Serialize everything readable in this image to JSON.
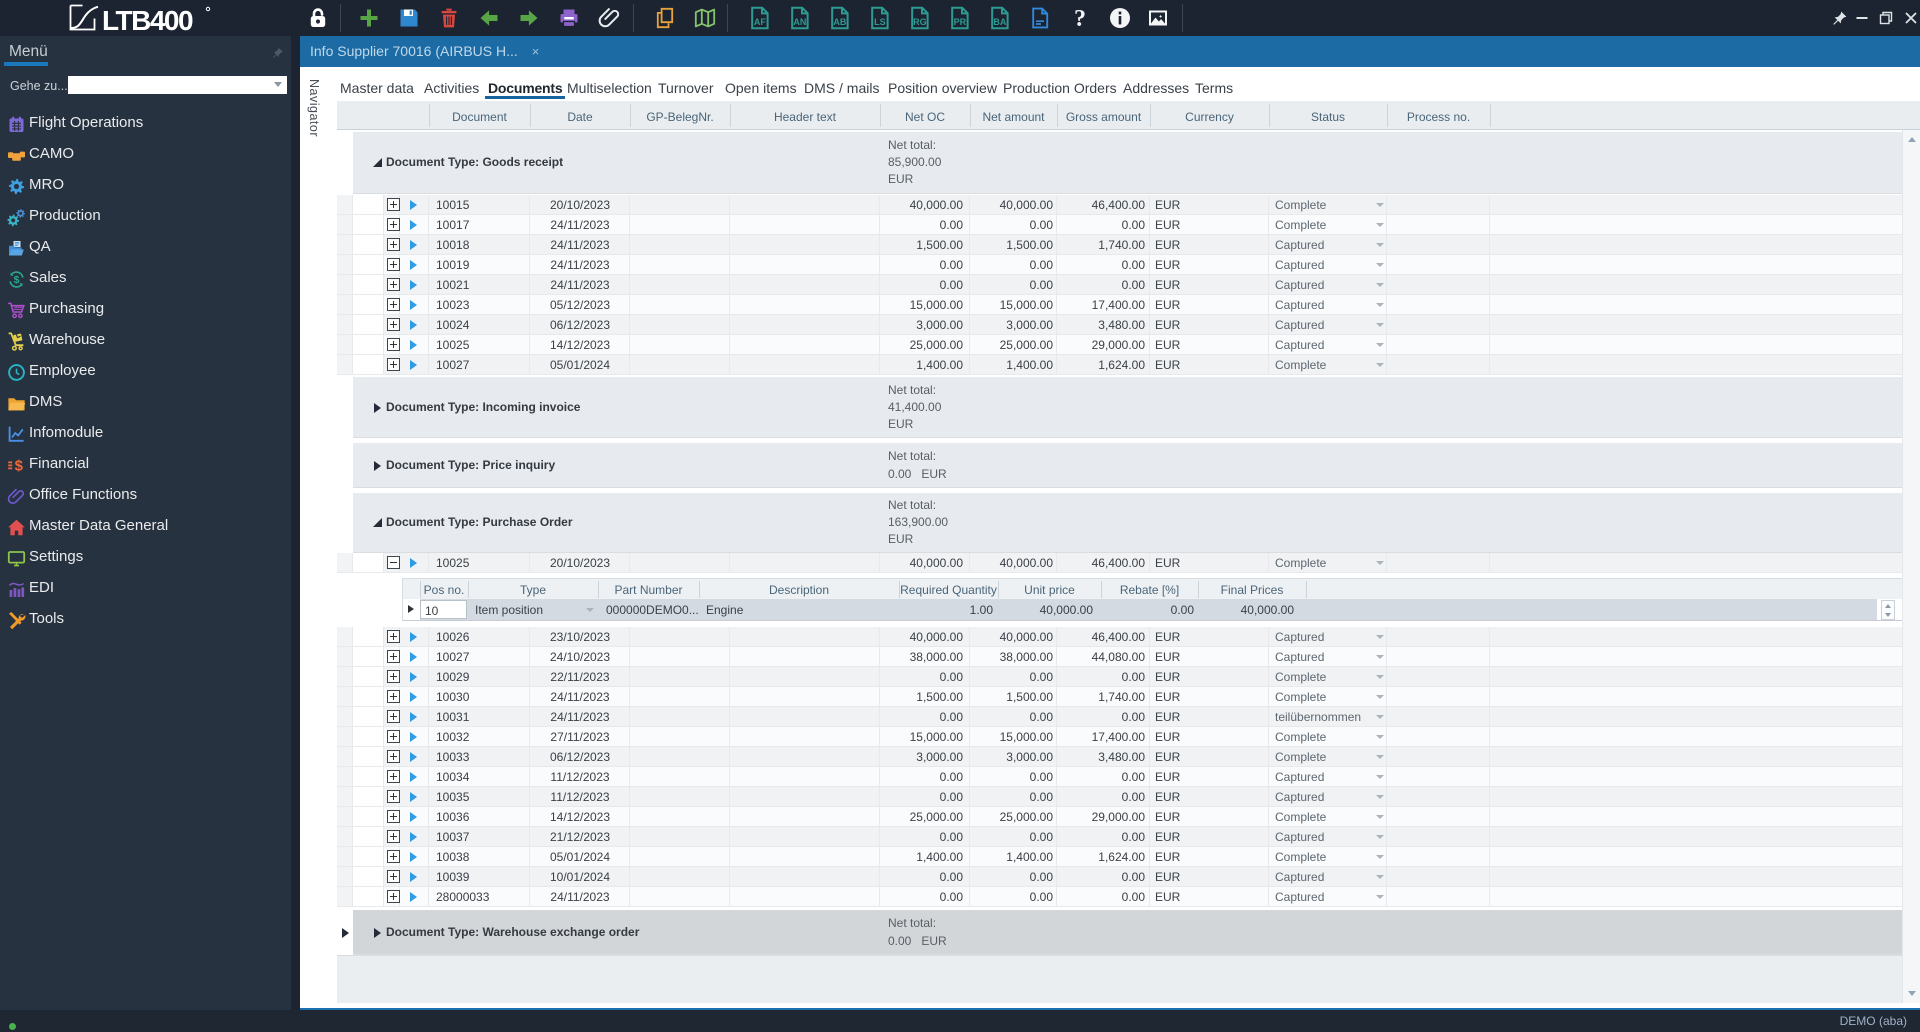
{
  "colors": {
    "topbar_bg": "#1c2431",
    "sidebar_bg": "#273240",
    "statusbar_bg": "#1f2733",
    "tab_blue": "#1d6ba5",
    "accent_blue": "#1a6fae",
    "underline_blue": "#1a79bd",
    "header_bg": "#e9edf0",
    "group_bg": "#e7eaee",
    "group_selected_bg": "#d3d6d9",
    "subrow_bg": "#d3dae2",
    "status_green": "#4db04e"
  },
  "window": {
    "logo_text": "LTB400",
    "status_user": "DEMO (aba)"
  },
  "window_buttons": [
    {
      "icon": "pin-icon"
    },
    {
      "icon": "minimize-icon"
    },
    {
      "icon": "restore-icon"
    },
    {
      "icon": "close-icon"
    }
  ],
  "toolbar": {
    "icons": [
      {
        "icon": "lock-icon"
      },
      {
        "sep": true
      },
      {
        "icon": "add-icon"
      },
      {
        "icon": "save-icon"
      },
      {
        "icon": "delete-icon"
      },
      {
        "icon": "back-arrow-icon"
      },
      {
        "icon": "forward-arrow-icon"
      },
      {
        "icon": "print-icon"
      },
      {
        "icon": "attachment-icon"
      },
      {
        "sep": true
      },
      {
        "icon": "copy-icon"
      },
      {
        "icon": "map-icon"
      },
      {
        "sep": true
      },
      {
        "icon": "doc-icon",
        "label": "AF"
      },
      {
        "icon": "doc-icon",
        "label": "AN"
      },
      {
        "icon": "doc-icon",
        "label": "AB"
      },
      {
        "icon": "doc-icon",
        "label": "LS"
      },
      {
        "icon": "doc-icon",
        "label": "RG"
      },
      {
        "icon": "doc-icon",
        "label": "PR"
      },
      {
        "icon": "doc-icon",
        "label": "BA"
      },
      {
        "icon": "doc-blue-icon"
      },
      {
        "icon": "help-icon"
      },
      {
        "icon": "info-icon"
      },
      {
        "icon": "image-icon"
      },
      {
        "sep": true
      }
    ]
  },
  "sidebar": {
    "title": "Menü",
    "goto_label": "Gehe zu...",
    "goto_value": "",
    "items": [
      {
        "label": "Flight Operations",
        "icon": "flight-operations-icon"
      },
      {
        "label": "CAMO",
        "icon": "camo-icon"
      },
      {
        "label": "MRO",
        "icon": "mro-icon"
      },
      {
        "label": "Production",
        "icon": "production-icon"
      },
      {
        "label": "QA",
        "icon": "qa-icon"
      },
      {
        "label": "Sales",
        "icon": "sales-icon"
      },
      {
        "label": "Purchasing",
        "icon": "purchasing-icon"
      },
      {
        "label": "Warehouse",
        "icon": "warehouse-icon"
      },
      {
        "label": "Employee",
        "icon": "employee-icon"
      },
      {
        "label": "DMS",
        "icon": "dms-icon"
      },
      {
        "label": "Infomodule",
        "icon": "infomodule-icon"
      },
      {
        "label": "Financial",
        "icon": "financial-icon"
      },
      {
        "label": "Office Functions",
        "icon": "office-functions-icon"
      },
      {
        "label": "Master Data General",
        "icon": "master-data-icon"
      },
      {
        "label": "Settings",
        "icon": "settings-icon"
      },
      {
        "label": "EDI",
        "icon": "edi-icon"
      },
      {
        "label": "Tools",
        "icon": "tools-icon"
      }
    ]
  },
  "document_tab": {
    "title": "Info Supplier 70016 (AIRBUS H...",
    "close": "×"
  },
  "navigator": {
    "label": "Navigator"
  },
  "content_tabs": {
    "active": "Documents",
    "items": [
      "Master data",
      "Activities",
      "Documents",
      "Multiselection",
      "Turnover",
      "Open items",
      "DMS / mails",
      "Position overview",
      "Production Orders",
      "Addresses",
      "Terms"
    ]
  },
  "grid": {
    "columns": [
      "Document",
      "Date",
      "GP-BelegNr.",
      "Header text",
      "Net OC",
      "Net amount",
      "Gross amount",
      "Currency",
      "Status",
      "Process no."
    ],
    "groups": [
      {
        "label": "Document Type: Goods receipt",
        "expanded": true,
        "compact": false,
        "net_total": {
          "caption": "Net total:",
          "value": "85,900.00",
          "currency": "EUR"
        },
        "rows": [
          {
            "document": "10015",
            "date": "20/10/2023",
            "net_oc": "40,000.00",
            "net_amount": "40,000.00",
            "gross_amount": "46,400.00",
            "currency": "EUR",
            "status": "Complete",
            "alt": true
          },
          {
            "document": "10017",
            "date": "24/11/2023",
            "net_oc": "0.00",
            "net_amount": "0.00",
            "gross_amount": "0.00",
            "currency": "EUR",
            "status": "Complete",
            "alt": false
          },
          {
            "document": "10018",
            "date": "24/11/2023",
            "net_oc": "1,500.00",
            "net_amount": "1,500.00",
            "gross_amount": "1,740.00",
            "currency": "EUR",
            "status": "Captured",
            "alt": true
          },
          {
            "document": "10019",
            "date": "24/11/2023",
            "net_oc": "0.00",
            "net_amount": "0.00",
            "gross_amount": "0.00",
            "currency": "EUR",
            "status": "Captured",
            "alt": false
          },
          {
            "document": "10021",
            "date": "24/11/2023",
            "net_oc": "0.00",
            "net_amount": "0.00",
            "gross_amount": "0.00",
            "currency": "EUR",
            "status": "Captured",
            "alt": true
          },
          {
            "document": "10023",
            "date": "05/12/2023",
            "net_oc": "15,000.00",
            "net_amount": "15,000.00",
            "gross_amount": "17,400.00",
            "currency": "EUR",
            "status": "Captured",
            "alt": false
          },
          {
            "document": "10024",
            "date": "06/12/2023",
            "net_oc": "3,000.00",
            "net_amount": "3,000.00",
            "gross_amount": "3,480.00",
            "currency": "EUR",
            "status": "Captured",
            "alt": true
          },
          {
            "document": "10025",
            "date": "14/12/2023",
            "net_oc": "25,000.00",
            "net_amount": "25,000.00",
            "gross_amount": "29,000.00",
            "currency": "EUR",
            "status": "Captured",
            "alt": false
          },
          {
            "document": "10027",
            "date": "05/01/2024",
            "net_oc": "1,400.00",
            "net_amount": "1,400.00",
            "gross_amount": "1,624.00",
            "currency": "EUR",
            "status": "Complete",
            "alt": true
          }
        ]
      },
      {
        "label": "Document Type: Incoming invoice",
        "expanded": false,
        "compact": false,
        "net_total": {
          "caption": "Net total:",
          "value": "41,400.00",
          "currency": "EUR"
        },
        "rows": []
      },
      {
        "label": "Document Type: Price inquiry",
        "expanded": false,
        "compact": true,
        "net_total": {
          "caption": "Net total:",
          "value": "0.00",
          "currency": "EUR"
        },
        "rows": []
      },
      {
        "label": "Document Type: Purchase Order",
        "expanded": true,
        "compact": false,
        "net_total": {
          "caption": "Net total:",
          "value": "163,900.00",
          "currency": "EUR"
        },
        "rows": [
          {
            "document": "10025",
            "date": "20/10/2023",
            "net_oc": "40,000.00",
            "net_amount": "40,000.00",
            "gross_amount": "46,400.00",
            "currency": "EUR",
            "status": "Complete",
            "alt": true,
            "expanded": true
          },
          {
            "document": "10026",
            "date": "23/10/2023",
            "net_oc": "40,000.00",
            "net_amount": "40,000.00",
            "gross_amount": "46,400.00",
            "currency": "EUR",
            "status": "Captured",
            "alt": true
          },
          {
            "document": "10027",
            "date": "24/10/2023",
            "net_oc": "38,000.00",
            "net_amount": "38,000.00",
            "gross_amount": "44,080.00",
            "currency": "EUR",
            "status": "Captured",
            "alt": false
          },
          {
            "document": "10029",
            "date": "22/11/2023",
            "net_oc": "0.00",
            "net_amount": "0.00",
            "gross_amount": "0.00",
            "currency": "EUR",
            "status": "Complete",
            "alt": true
          },
          {
            "document": "10030",
            "date": "24/11/2023",
            "net_oc": "1,500.00",
            "net_amount": "1,500.00",
            "gross_amount": "1,740.00",
            "currency": "EUR",
            "status": "Complete",
            "alt": false
          },
          {
            "document": "10031",
            "date": "24/11/2023",
            "net_oc": "0.00",
            "net_amount": "0.00",
            "gross_amount": "0.00",
            "currency": "EUR",
            "status": "teilübernommen",
            "alt": true
          },
          {
            "document": "10032",
            "date": "27/11/2023",
            "net_oc": "15,000.00",
            "net_amount": "15,000.00",
            "gross_amount": "17,400.00",
            "currency": "EUR",
            "status": "Complete",
            "alt": false
          },
          {
            "document": "10033",
            "date": "06/12/2023",
            "net_oc": "3,000.00",
            "net_amount": "3,000.00",
            "gross_amount": "3,480.00",
            "currency": "EUR",
            "status": "Complete",
            "alt": true
          },
          {
            "document": "10034",
            "date": "11/12/2023",
            "net_oc": "0.00",
            "net_amount": "0.00",
            "gross_amount": "0.00",
            "currency": "EUR",
            "status": "Captured",
            "alt": false
          },
          {
            "document": "10035",
            "date": "11/12/2023",
            "net_oc": "0.00",
            "net_amount": "0.00",
            "gross_amount": "0.00",
            "currency": "EUR",
            "status": "Captured",
            "alt": true
          },
          {
            "document": "10036",
            "date": "14/12/2023",
            "net_oc": "25,000.00",
            "net_amount": "25,000.00",
            "gross_amount": "29,000.00",
            "currency": "EUR",
            "status": "Complete",
            "alt": false
          },
          {
            "document": "10037",
            "date": "21/12/2023",
            "net_oc": "0.00",
            "net_amount": "0.00",
            "gross_amount": "0.00",
            "currency": "EUR",
            "status": "Captured",
            "alt": true
          },
          {
            "document": "10038",
            "date": "05/01/2024",
            "net_oc": "1,400.00",
            "net_amount": "1,400.00",
            "gross_amount": "1,624.00",
            "currency": "EUR",
            "status": "Complete",
            "alt": false
          },
          {
            "document": "10039",
            "date": "10/01/2024",
            "net_oc": "0.00",
            "net_amount": "0.00",
            "gross_amount": "0.00",
            "currency": "EUR",
            "status": "Captured",
            "alt": true
          },
          {
            "document": "28000033",
            "date": "24/11/2023",
            "net_oc": "0.00",
            "net_amount": "0.00",
            "gross_amount": "0.00",
            "currency": "EUR",
            "status": "Captured",
            "alt": false
          }
        ]
      },
      {
        "label": "Document Type: Warehouse exchange order",
        "expanded": false,
        "compact": true,
        "selected": true,
        "net_total": {
          "caption": "Net total:",
          "value": "0.00",
          "currency": "EUR"
        },
        "rows": []
      }
    ],
    "sub_table": {
      "columns": [
        "Pos no.",
        "Type",
        "Part Number",
        "Description",
        "Required Quantity",
        "Unit price",
        "Rebate [%]",
        "Final Prices"
      ],
      "row": {
        "pos_no": "10",
        "type": "Item position",
        "part_number": "000000DEMO0...",
        "description": "Engine",
        "required_quantity": "1.00",
        "unit_price": "40,000.00",
        "rebate": "0.00",
        "final_prices": "40,000.00"
      }
    }
  }
}
